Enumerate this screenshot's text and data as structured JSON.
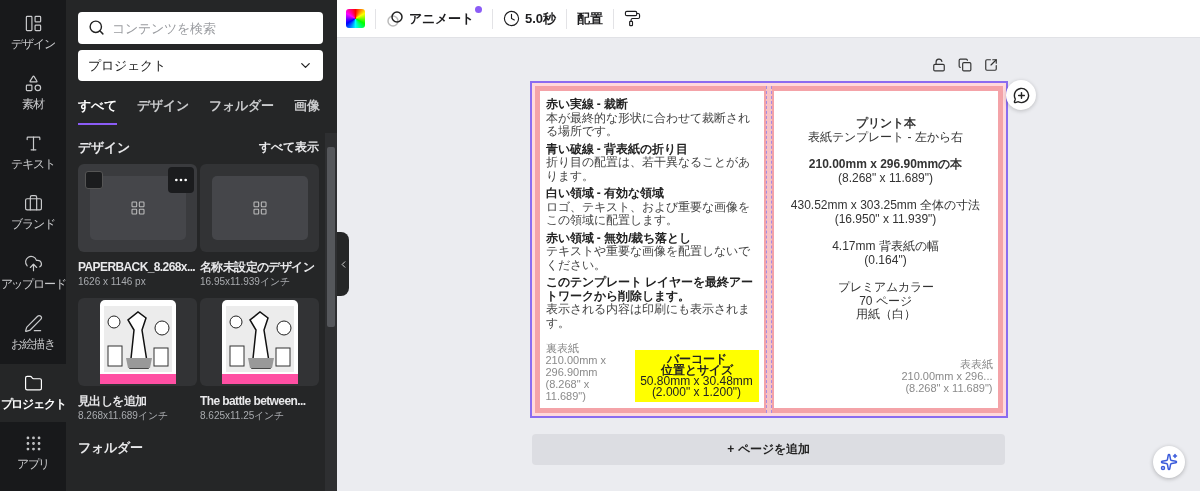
{
  "rail": [
    {
      "label": "デザイン",
      "selected": false
    },
    {
      "label": "素材",
      "selected": false
    },
    {
      "label": "テキスト",
      "selected": false
    },
    {
      "label": "ブランド",
      "selected": false
    },
    {
      "label": "アップロード",
      "selected": false
    },
    {
      "label": "お絵描き",
      "selected": false
    },
    {
      "label": "プロジェクト",
      "selected": true
    },
    {
      "label": "アプリ",
      "selected": false
    }
  ],
  "panel": {
    "search": {
      "placeholder": "コンテンツを検索"
    },
    "dropdown": {
      "value": "プロジェクト"
    },
    "tabs": [
      {
        "label": "すべて",
        "selected": true
      },
      {
        "label": "デザイン",
        "selected": false
      },
      {
        "label": "フォルダー",
        "selected": false
      },
      {
        "label": "画像",
        "selected": false
      }
    ],
    "designs_heading": "デザイン",
    "see_all": "すべて表示",
    "designs": [
      {
        "kind": "blank",
        "title": "PAPERBACK_8.268x...",
        "size": "1626 x 1146 px",
        "hovered": true,
        "checked": false
      },
      {
        "kind": "blank",
        "title": "名称未設定のデザイン",
        "size": "16.95x11.939インチ",
        "hovered": false,
        "checked": false
      },
      {
        "kind": "picture",
        "title": "見出しを追加",
        "size": "8.268x11.689インチ",
        "hovered": false,
        "checked": false
      },
      {
        "kind": "picture",
        "title": "The battle between...",
        "size": "8.625x11.25インチ",
        "hovered": false,
        "checked": false
      }
    ],
    "folders_heading": "フォルダー"
  },
  "toolbar": {
    "animate": "アニメート",
    "duration": "5.0秒",
    "position": "配置"
  },
  "page": {
    "left_notes": [
      {
        "heading": "赤い実線 - 裁断",
        "body": "本が最終的な形状に合わせて裁断される場所です。"
      },
      {
        "heading": "青い破線 - 背表紙の折り目",
        "body": "折り目の配置は、若干異なることがあります。"
      },
      {
        "heading": "白い領域 - 有効な領域",
        "body": "ロゴ、テキスト、および重要な画像をこの領域に配置します。"
      },
      {
        "heading": "赤い領域 - 無効/裁ち落とし",
        "body": "テキストや重要な画像を配置しないでください。"
      },
      {
        "heading": "このテンプレート レイヤーを最終アートワークから削除します。",
        "body": "表示される内容は印刷にも表示されます。"
      }
    ],
    "back_cover": [
      "裏表紙",
      "210.00mm x",
      "296.90mm",
      "(8.268\" x",
      "11.689\")"
    ],
    "barcode": [
      "バーコード",
      "位置とサイズ",
      "50.80mm x 30.48mm",
      "(2.000\" x 1.200\")"
    ],
    "front_cover": [
      "表表紙",
      "210.00mm x 296...",
      "(8.268\" x 11.689\")"
    ],
    "right_blocks": [
      [
        "プリント本",
        "表紙テンプレート - 左から右"
      ],
      [
        "210.00mm x 296.90mmの本",
        "(8.268\" x 11.689\")"
      ],
      [
        "430.52mm x 303.25mm 全体の寸法",
        "(16.950\" x 11.939\")"
      ],
      [
        "4.17mm 背表紙の幅",
        "(0.164\")"
      ],
      [
        "プレミアムカラー",
        "70 ページ",
        "用紙（白）"
      ]
    ]
  },
  "add_page": "+ ページを追加"
}
